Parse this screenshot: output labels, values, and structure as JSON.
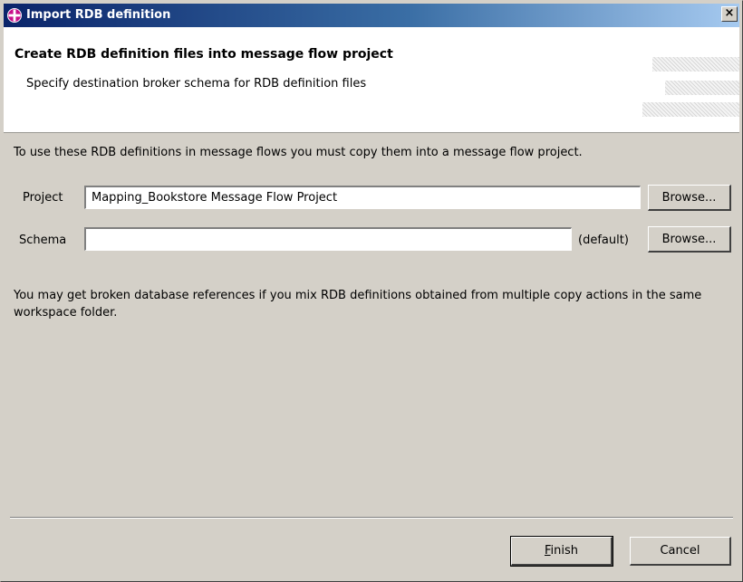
{
  "window": {
    "title": "Import RDB definition",
    "close_label": "×"
  },
  "banner": {
    "title": "Create RDB definition files into message flow project",
    "description": "Specify destination broker schema for RDB definition files"
  },
  "content": {
    "intro": "To use these RDB definitions in message flows you must copy them into a message flow project.",
    "project": {
      "label": "Project",
      "value": "Mapping_Bookstore Message Flow Project",
      "browse_label": "Browse..."
    },
    "schema": {
      "label": "Schema",
      "value": "",
      "default_label": "(default)",
      "browse_label": "Browse..."
    },
    "warning": "You may get broken database references if you mix RDB definitions obtained from multiple copy actions in the same workspace folder."
  },
  "footer": {
    "finish_mnemonic": "F",
    "finish_rest": "inish",
    "cancel_label": "Cancel"
  }
}
